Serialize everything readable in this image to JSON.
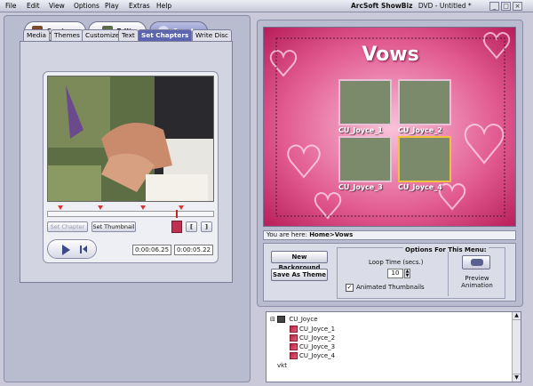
{
  "menu": {
    "items": [
      "File",
      "Edit",
      "View",
      "Options",
      "Play",
      "Extras",
      "Help"
    ]
  },
  "window": {
    "app_name": "ArcSoft ShowBiz",
    "document": "DVD - Untitled *",
    "min": "_",
    "max": "□",
    "close": "×"
  },
  "modes": {
    "capture": "Capture",
    "edit": "Edit",
    "create": "Create"
  },
  "tabs": [
    "Media",
    "Themes",
    "Customize",
    "Text",
    "Set Chapters",
    "Write Disc"
  ],
  "player": {
    "set_chapter": "Set Chapter",
    "set_thumbnail": "Set Thumbnail",
    "time_current": "0:00:06.25",
    "time_total": "0:00:05.22",
    "bracket_in": "[",
    "bracket_out": "]"
  },
  "preview": {
    "menu_title": "Vows",
    "thumbs": [
      "CU_Joyce_1",
      "CU_Joyce_2",
      "CU_Joyce_3",
      "CU_Joyce_4"
    ]
  },
  "breadcrumb": {
    "prefix": "You are here: ",
    "path": "Home>Vows"
  },
  "options": {
    "new_background": "New Background",
    "save_as_theme": "Save As Theme",
    "group_title": "Options For This Menu:",
    "loop_label": "Loop Time (secs.)",
    "loop_value": "10",
    "animated_label": "Animated Thumbnails",
    "preview_label": "Preview Animation"
  },
  "tree": {
    "root": "CU_Joyce",
    "children": [
      "CU_Joyce_1",
      "CU_Joyce_2",
      "CU_Joyce_3",
      "CU_Joyce_4"
    ],
    "last": "vkt"
  }
}
